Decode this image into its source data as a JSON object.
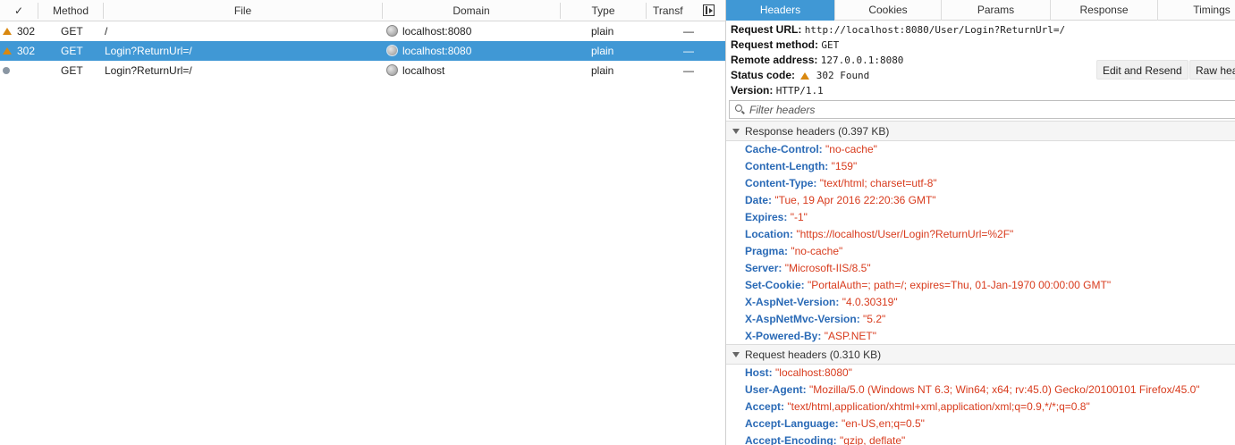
{
  "request_table": {
    "columns": [
      "✓",
      "Method",
      "File",
      "Domain",
      "Type",
      "Transf"
    ],
    "rows": [
      {
        "status": "302",
        "status_icon": "warning-icon",
        "method": "GET",
        "file": "/",
        "domain": "localhost:8080",
        "type": "plain",
        "transferred": "—",
        "selected": false
      },
      {
        "status": "302",
        "status_icon": "warning-icon",
        "method": "GET",
        "file": "Login?ReturnUrl=/",
        "domain": "localhost:8080",
        "type": "plain",
        "transferred": "—",
        "selected": true
      },
      {
        "status": "",
        "status_icon": "pending-dot-icon",
        "method": "GET",
        "file": "Login?ReturnUrl=/",
        "domain": "localhost",
        "type": "plain",
        "transferred": "—",
        "selected": false
      }
    ]
  },
  "details": {
    "tabs": [
      "Headers",
      "Cookies",
      "Params",
      "Response",
      "Timings"
    ],
    "active_tab": "Headers",
    "summary": {
      "url_label": "Request URL:",
      "url_value": "http://localhost:8080/User/Login?ReturnUrl=/",
      "method_label": "Request method:",
      "method_value": "GET",
      "address_label": "Remote address:",
      "address_value": "127.0.0.1:8080",
      "status_label": "Status code:",
      "status_value": "302 Found",
      "version_label": "Version:",
      "version_value": "HTTP/1.1"
    },
    "buttons": {
      "edit_resend": "Edit and Resend",
      "raw_headers": "Raw headers"
    },
    "filter_placeholder": "Filter headers",
    "response_section": {
      "label": "Response headers (0.397 KB)",
      "headers": [
        {
          "name": "Cache-Control:",
          "value": "\"no-cache\""
        },
        {
          "name": "Content-Length:",
          "value": "\"159\""
        },
        {
          "name": "Content-Type:",
          "value": "\"text/html; charset=utf-8\""
        },
        {
          "name": "Date:",
          "value": "\"Tue, 19 Apr 2016 22:20:36 GMT\""
        },
        {
          "name": "Expires:",
          "value": "\"-1\""
        },
        {
          "name": "Location:",
          "value": "\"https://localhost/User/Login?ReturnUrl=%2F\""
        },
        {
          "name": "Pragma:",
          "value": "\"no-cache\""
        },
        {
          "name": "Server:",
          "value": "\"Microsoft-IIS/8.5\""
        },
        {
          "name": "Set-Cookie:",
          "value": "\"PortalAuth=; path=/; expires=Thu, 01-Jan-1970 00:00:00 GMT\""
        },
        {
          "name": "X-AspNet-Version:",
          "value": "\"4.0.30319\""
        },
        {
          "name": "X-AspNetMvc-Version:",
          "value": "\"5.2\""
        },
        {
          "name": "X-Powered-By:",
          "value": "\"ASP.NET\""
        }
      ]
    },
    "request_section": {
      "label": "Request headers (0.310 KB)",
      "headers": [
        {
          "name": "Host:",
          "value": "\"localhost:8080\""
        },
        {
          "name": "User-Agent:",
          "value": "\"Mozilla/5.0 (Windows NT 6.3; Win64; x64; rv:45.0) Gecko/20100101 Firefox/45.0\""
        },
        {
          "name": "Accept:",
          "value": "\"text/html,application/xhtml+xml,application/xml;q=0.9,*/*;q=0.8\""
        },
        {
          "name": "Accept-Language:",
          "value": "\"en-US,en;q=0.5\""
        },
        {
          "name": "Accept-Encoding:",
          "value": "\"gzip, deflate\""
        }
      ]
    }
  },
  "colors": {
    "accent": "#4098d5",
    "header_name": "#2a6ab6",
    "header_value": "#d83b1d",
    "warning": "#d9880f"
  }
}
